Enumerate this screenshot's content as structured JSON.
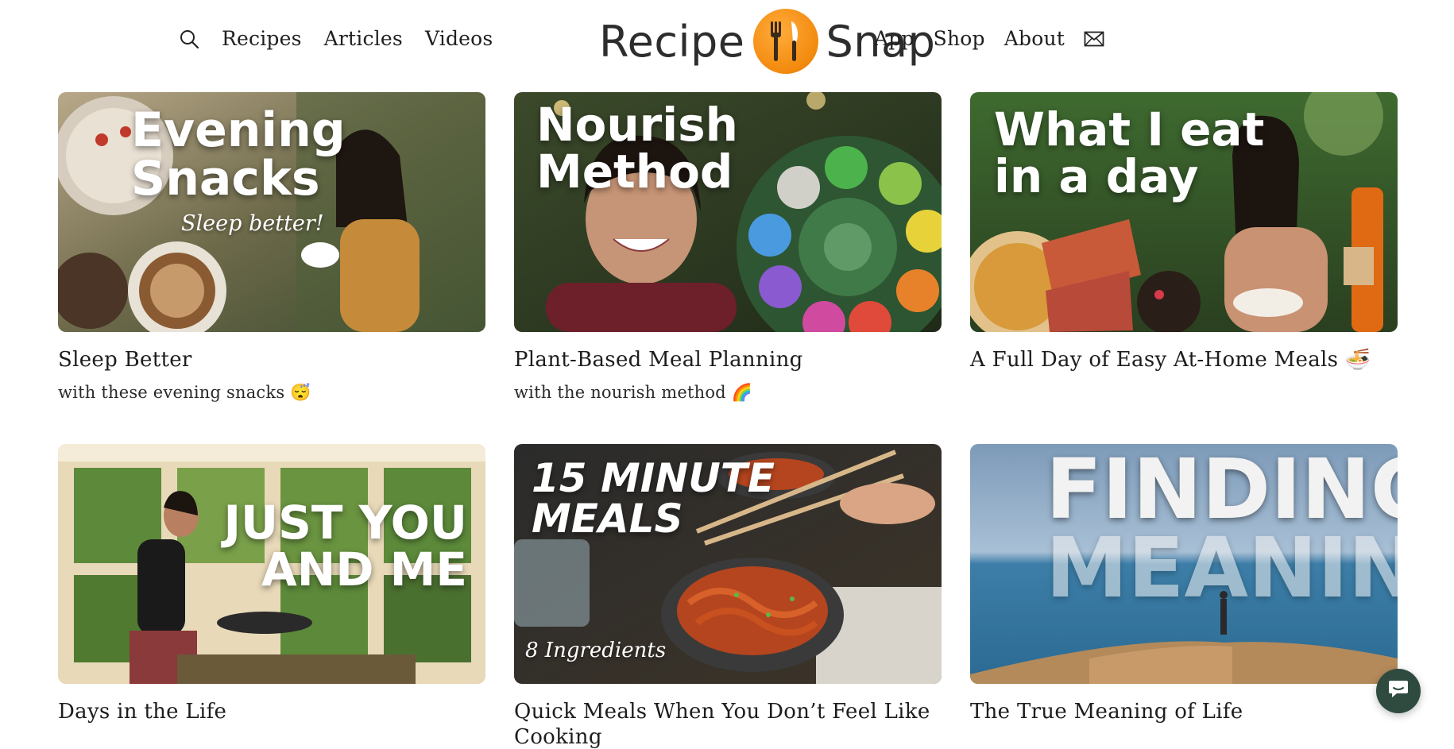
{
  "nav": {
    "left": [
      "Recipes",
      "Articles",
      "Videos"
    ],
    "right": [
      "App",
      "Shop",
      "About"
    ],
    "search_icon": "search-icon",
    "mail_icon": "mail-icon"
  },
  "logo": {
    "left": "Recipe",
    "right": "Snap",
    "icon": "fork-knife-icon",
    "color": "#f28a0e"
  },
  "cards": [
    {
      "title": "Sleep Better",
      "subtitle": "with these evening snacks 😴",
      "overlay": [
        "Evening",
        "Snacks"
      ],
      "overlay_script": "Sleep better!"
    },
    {
      "title": "Plant-Based Meal Planning",
      "subtitle": "with the nourish method 🌈",
      "overlay": [
        "Nourish Method"
      ]
    },
    {
      "title": "A Full Day of Easy At-Home Meals 🍜",
      "subtitle": "",
      "overlay": [
        "What I eat",
        "in a day"
      ]
    },
    {
      "title": "Days in the Life",
      "subtitle": "",
      "overlay": [
        "JUST YOU",
        "AND ME"
      ]
    },
    {
      "title": "Quick Meals When You Don’t Feel Like",
      "subtitle": "Cooking",
      "overlay": [
        "15 MINUTE",
        "MEALS"
      ],
      "overlay_script": "8 Ingredients"
    },
    {
      "title": "The True Meaning of Life",
      "subtitle": "",
      "overlay": [
        "FINDING",
        "MEANING"
      ]
    }
  ],
  "chat": {
    "icon": "chat-icon",
    "color": "#2f4a3f"
  }
}
